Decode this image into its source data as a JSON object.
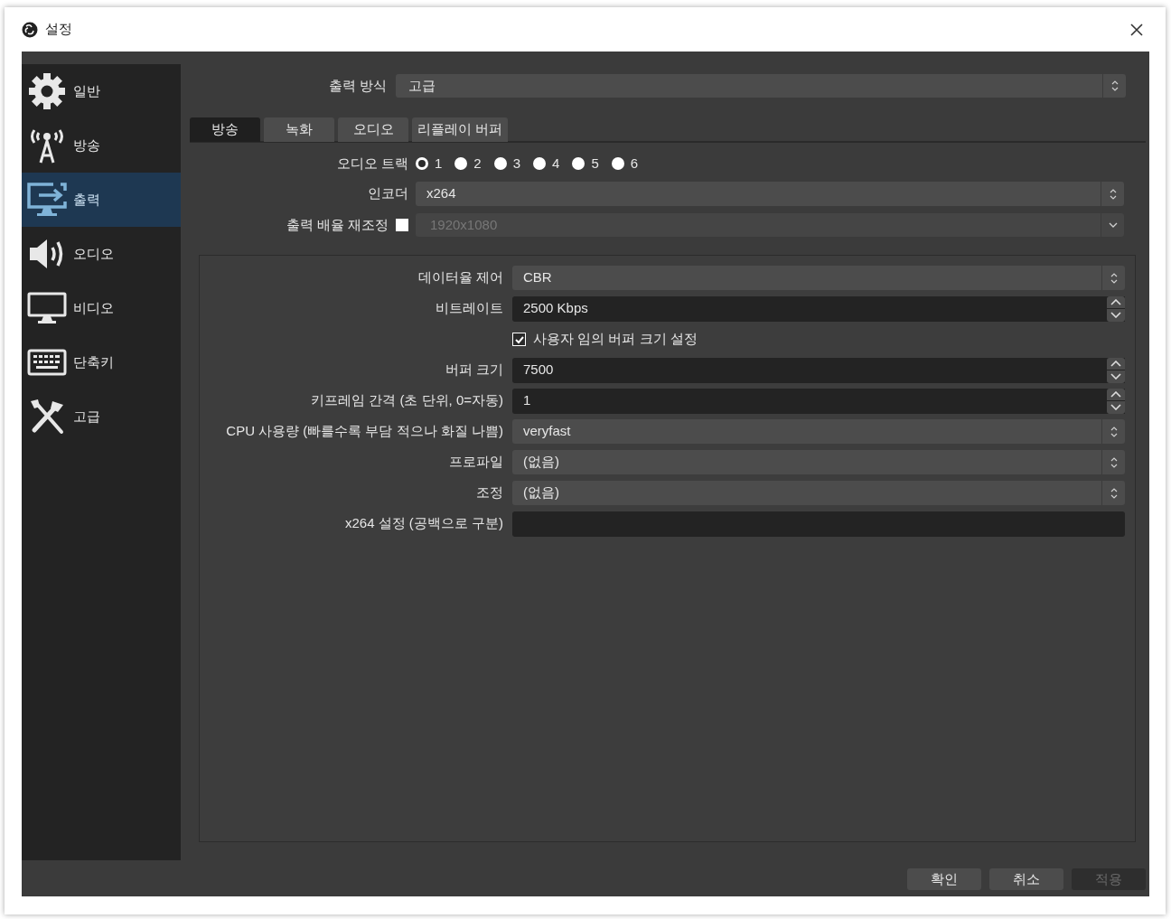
{
  "window": {
    "title": "설정"
  },
  "sidebar": {
    "items": [
      {
        "label": "일반",
        "selected": false
      },
      {
        "label": "방송",
        "selected": false
      },
      {
        "label": "출력",
        "selected": true
      },
      {
        "label": "오디오",
        "selected": false
      },
      {
        "label": "비디오",
        "selected": false
      },
      {
        "label": "단축키",
        "selected": false
      },
      {
        "label": "고급",
        "selected": false
      }
    ]
  },
  "output_mode": {
    "label": "출력 방식",
    "value": "고급"
  },
  "tabs": [
    {
      "label": "방송",
      "selected": true
    },
    {
      "label": "녹화",
      "selected": false
    },
    {
      "label": "오디오",
      "selected": false
    },
    {
      "label": "리플레이 버퍼",
      "selected": false
    }
  ],
  "streaming": {
    "audio_track": {
      "label": "오디오 트랙",
      "options": [
        {
          "label": "1",
          "selected": true
        },
        {
          "label": "2",
          "selected": false
        },
        {
          "label": "3",
          "selected": false
        },
        {
          "label": "4",
          "selected": false
        },
        {
          "label": "5",
          "selected": false
        },
        {
          "label": "6",
          "selected": false
        }
      ]
    },
    "encoder": {
      "label": "인코더",
      "value": "x264"
    },
    "rescale": {
      "label": "출력 배율 재조정",
      "checked": false,
      "value": "1920x1080"
    }
  },
  "encoder_settings": [
    {
      "kind": "combo",
      "label": "데이터율 제어",
      "value": "CBR"
    },
    {
      "kind": "spin",
      "label": "비트레이트",
      "value": "2500 Kbps"
    },
    {
      "kind": "checkbox",
      "label": "사용자 임의 버퍼 크기 설정",
      "checked": true
    },
    {
      "kind": "spin",
      "label": "버퍼 크기",
      "value": "7500"
    },
    {
      "kind": "spin",
      "label": "키프레임 간격 (초 단위, 0=자동)",
      "value": "1"
    },
    {
      "kind": "combo",
      "label": "CPU 사용량 (빠를수록 부담 적으나 화질 나쁨)",
      "value": "veryfast"
    },
    {
      "kind": "combo",
      "label": "프로파일",
      "value": "(없음)"
    },
    {
      "kind": "combo",
      "label": "조정",
      "value": "(없음)"
    },
    {
      "kind": "text",
      "label": "x264 설정 (공백으로 구분)"
    }
  ],
  "buttons": [
    {
      "label": "확인",
      "disabled": false
    },
    {
      "label": "취소",
      "disabled": false
    },
    {
      "label": "적용",
      "disabled": true
    }
  ]
}
